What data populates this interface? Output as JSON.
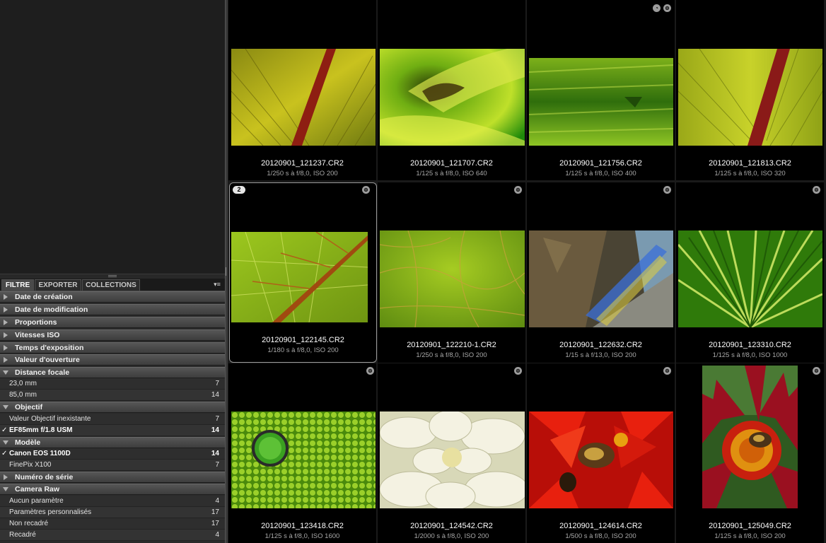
{
  "tabs": [
    {
      "label": "FILTRE",
      "active": true
    },
    {
      "label": "EXPORTER",
      "active": false
    },
    {
      "label": "COLLECTIONS",
      "active": false
    }
  ],
  "panel_menu_icon": "▾≡",
  "filters": {
    "date_creation": "Date de création",
    "date_modification": "Date de modification",
    "proportions": "Proportions",
    "vitesses_iso": "Vitesses ISO",
    "temps_exposition": "Temps d'exposition",
    "valeur_ouverture": "Valeur d'ouverture",
    "distance_focale": "Distance focale",
    "objectif": "Objectif",
    "modele": "Modèle",
    "numero_serie": "Numéro de série",
    "camera_raw": "Camera Raw"
  },
  "focal": [
    {
      "label": "23,0 mm",
      "count": "7"
    },
    {
      "label": "85,0 mm",
      "count": "14"
    }
  ],
  "lens": [
    {
      "label": "Valeur Objectif inexistante",
      "count": "7"
    },
    {
      "label": "EF85mm f/1.8 USM",
      "count": "14",
      "check": "✓"
    }
  ],
  "model": [
    {
      "label": "Canon EOS 1100D",
      "count": "14",
      "check": "✓"
    },
    {
      "label": "FinePix X100",
      "count": "7"
    }
  ],
  "raw": [
    {
      "label": "Aucun paramètre",
      "count": "4"
    },
    {
      "label": "Paramètres personnalisés",
      "count": "17"
    },
    {
      "label": "Non recadré",
      "count": "17"
    },
    {
      "label": "Recadré",
      "count": "4"
    }
  ],
  "thumbnails": [
    {
      "name": "20120901_121237.CR2",
      "info": "1/250 s à f/8,0, ISO 200"
    },
    {
      "name": "20120901_121707.CR2",
      "info": "1/125 s à f/8,0, ISO 640"
    },
    {
      "name": "20120901_121756.CR2",
      "info": "1/125 s à f/8,0, ISO 400"
    },
    {
      "name": "20120901_121813.CR2",
      "info": "1/125 s à f/8,0, ISO 320"
    },
    {
      "name": "20120901_122145.CR2",
      "info": "1/180 s à f/8,0, ISO 200",
      "stack": "2"
    },
    {
      "name": "20120901_122210-1.CR2",
      "info": "1/250 s à f/8,0, ISO 200"
    },
    {
      "name": "20120901_122632.CR2",
      "info": "1/15 s à f/13,0, ISO 200"
    },
    {
      "name": "20120901_123310.CR2",
      "info": "1/125 s à f/8,0, ISO 1000"
    },
    {
      "name": "20120901_123418.CR2",
      "info": "1/125 s à f/8,0, ISO 1600"
    },
    {
      "name": "20120901_124542.CR2",
      "info": "1/2000 s à f/8,0, ISO 200"
    },
    {
      "name": "20120901_124614.CR2",
      "info": "1/500 s à f/8,0, ISO 200"
    },
    {
      "name": "20120901_125049.CR2",
      "info": "1/125 s à f/8,0, ISO 200"
    }
  ]
}
